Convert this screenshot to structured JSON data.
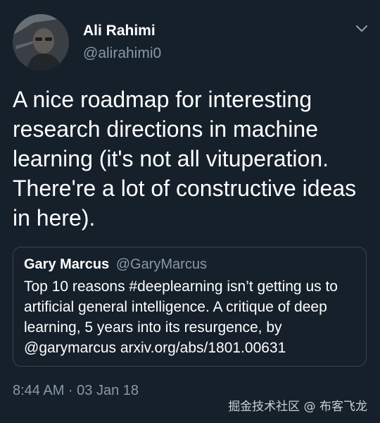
{
  "author": {
    "display_name": "Ali Rahimi",
    "handle": "@alirahimi0",
    "avatar_icon": "profile-photo"
  },
  "menu_icon": "chevron-down-icon",
  "tweet": {
    "text": "A nice roadmap for interesting research directions in machine learning (it's not all vituperation. There're a lot of constructive ideas in here)."
  },
  "quoted_tweet": {
    "display_name": "Gary Marcus",
    "handle": "@GaryMarcus",
    "text": "Top 10 reasons #deeplearning isn’t getting us to artificial general intelligence. A critique of deep learning, 5 years into its resurgence, by @garymarcus  arxiv.org/abs/1801.00631"
  },
  "timestamp": "8:44 AM · 03 Jan 18",
  "watermark": "掘金技术社区 @ 布客飞龙",
  "colors": {
    "background": "#15202b",
    "primary_text": "#ffffff",
    "secondary_text": "#8899a6",
    "border": "#38444d"
  }
}
